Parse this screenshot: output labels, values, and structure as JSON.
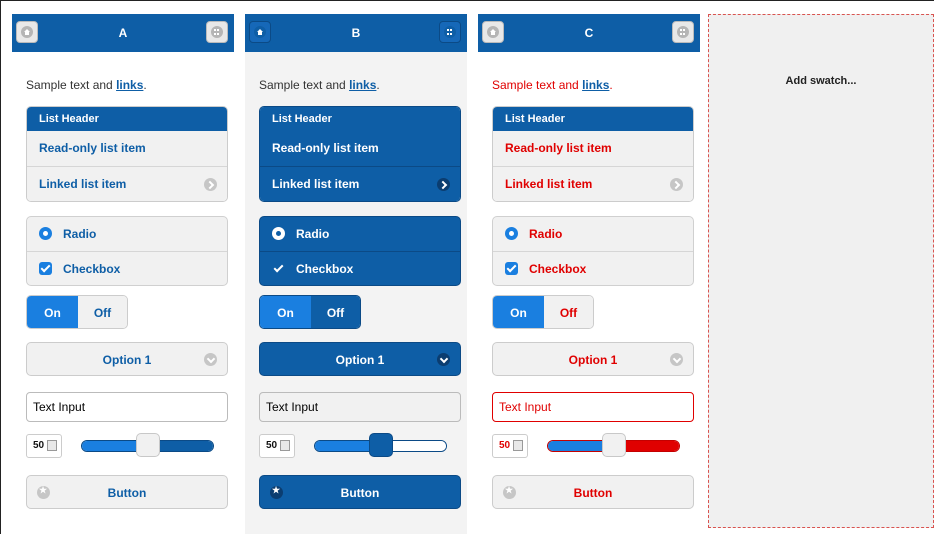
{
  "colors": {
    "header_blue": "#0e5ea6",
    "accent_blue": "#1a7fe0",
    "swatch_c_text": "#e00000",
    "add_swatch_border": "#d9534f"
  },
  "add_swatch": {
    "label": "Add swatch..."
  },
  "swatches": [
    {
      "title": "A",
      "left_icon": "home-icon",
      "right_icon": "grid-icon",
      "sample_text": "Sample text and ",
      "sample_link": "links",
      "sample_after": ".",
      "list_header": "List Header",
      "readonly_item": "Read-only list item",
      "linked_item": "Linked list item",
      "radio_label": "Radio",
      "checkbox_label": "Checkbox",
      "flip_on": "On",
      "flip_off": "Off",
      "select_value": "Option 1",
      "text_input_value": "Text Input",
      "slider_value": "50",
      "slider_fraction": 0.5,
      "button_label": "Button"
    },
    {
      "title": "B",
      "left_icon": "home-icon",
      "right_icon": "grid-icon",
      "sample_text": "Sample text and ",
      "sample_link": "links",
      "sample_after": ".",
      "list_header": "List Header",
      "readonly_item": "Read-only list item",
      "linked_item": "Linked list item",
      "radio_label": "Radio",
      "checkbox_label": "Checkbox",
      "flip_on": "On",
      "flip_off": "Off",
      "select_value": "Option 1",
      "text_input_value": "Text Input",
      "slider_value": "50",
      "slider_fraction": 0.5,
      "button_label": "Button"
    },
    {
      "title": "C",
      "left_icon": "home-icon",
      "right_icon": "grid-icon",
      "sample_text": "Sample text and ",
      "sample_link": "links",
      "sample_after": ".",
      "list_header": "List Header",
      "readonly_item": "Read-only list item",
      "linked_item": "Linked list item",
      "radio_label": "Radio",
      "checkbox_label": "Checkbox",
      "flip_on": "On",
      "flip_off": "Off",
      "select_value": "Option 1",
      "text_input_value": "Text Input",
      "slider_value": "50",
      "slider_fraction": 0.5,
      "button_label": "Button"
    }
  ]
}
